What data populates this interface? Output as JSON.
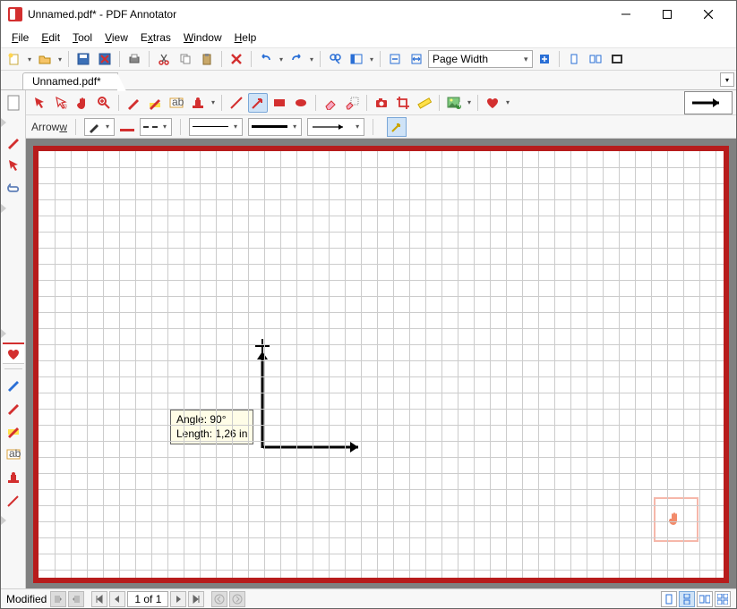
{
  "window": {
    "title": "Unnamed.pdf* - PDF Annotator"
  },
  "menu": {
    "file": "File",
    "edit": "Edit",
    "tool": "Tool",
    "view": "View",
    "extras": "Extras",
    "window": "Window",
    "help": "Help"
  },
  "zoom": {
    "label": "Page Width"
  },
  "tab": {
    "label": "Unnamed.pdf*"
  },
  "props": {
    "label": "Arrow"
  },
  "tooltip": {
    "line1": "Angle: 90°",
    "line2": "Length: 1,26 in"
  },
  "status": {
    "text": "Modified",
    "page": "1 of 1"
  }
}
